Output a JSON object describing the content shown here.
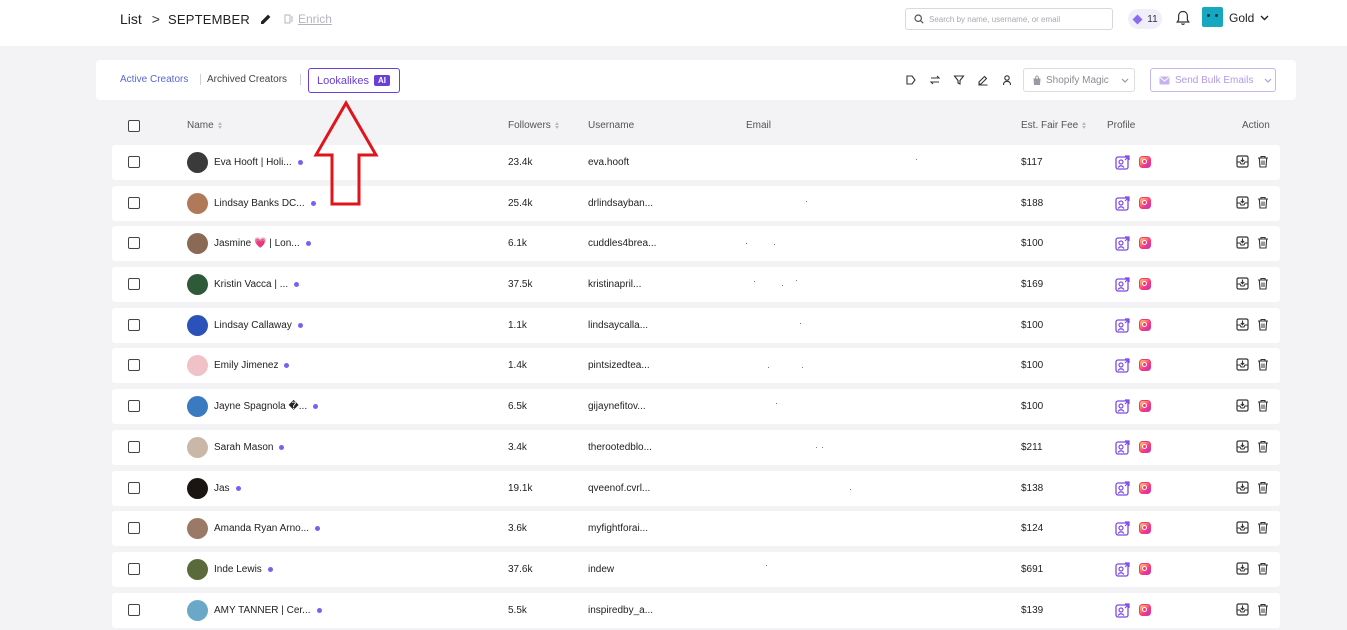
{
  "header": {
    "breadcrumb_root": "List",
    "breadcrumb_sep": ">",
    "list_name": "SEPTEMBER",
    "enrich_label": "Enrich",
    "search_placeholder": "Search by name, username, or email",
    "credits": "11",
    "plan": "Gold"
  },
  "tabs": {
    "active": "Active Creators",
    "archived": "Archived Creators",
    "lookalikes": "Lookalikes",
    "ai_badge": "AI"
  },
  "toolbar": {
    "shopify_label": "Shopify Magic",
    "bulk_email_label": "Send Bulk Emails",
    "icons": [
      "tag-icon",
      "swap-icon",
      "filter-icon",
      "edit-icon",
      "user-icon"
    ]
  },
  "columns": {
    "name": "Name",
    "followers": "Followers",
    "username": "Username",
    "email": "Email",
    "fee": "Est. Fair Fee",
    "profile": "Profile",
    "action": "Action"
  },
  "rows": [
    {
      "name": "Eva Hooft | Holi...",
      "followers": "23.4k",
      "username": "eva.hooft",
      "fee": "$117",
      "avatar_color": "#3a3a3a"
    },
    {
      "name": "Lindsay Banks DC...",
      "followers": "25.4k",
      "username": "drlindsayban...",
      "fee": "$188",
      "avatar_color": "#b07a5a"
    },
    {
      "name": "Jasmine 💗 | Lon...",
      "followers": "6.1k",
      "username": "cuddles4brea...",
      "fee": "$100",
      "avatar_color": "#8a6a55"
    },
    {
      "name": "Kristin Vacca | ...",
      "followers": "37.5k",
      "username": "kristinapril...",
      "fee": "$169",
      "avatar_color": "#2f5a3a"
    },
    {
      "name": "Lindsay Callaway",
      "followers": "1.1k",
      "username": "lindsaycalla...",
      "fee": "$100",
      "avatar_color": "#2a52b8"
    },
    {
      "name": "Emily Jimenez",
      "followers": "1.4k",
      "username": "pintsizedtea...",
      "fee": "$100",
      "avatar_color": "#f0c2c8"
    },
    {
      "name": "Jayne Spagnola �...",
      "followers": "6.5k",
      "username": "gijaynefitov...",
      "fee": "$100",
      "avatar_color": "#3a7ac0"
    },
    {
      "name": "Sarah Mason",
      "followers": "3.4k",
      "username": "therootedblo...",
      "fee": "$211",
      "avatar_color": "#c9b8a8"
    },
    {
      "name": "Jas",
      "followers": "19.1k",
      "username": "qveenof.cvrl...",
      "fee": "$138",
      "avatar_color": "#1a1412"
    },
    {
      "name": "Amanda Ryan Arno...",
      "followers": "3.6k",
      "username": "myfightforai...",
      "fee": "$124",
      "avatar_color": "#9a7a66"
    },
    {
      "name": "Inde Lewis",
      "followers": "37.6k",
      "username": "indew",
      "fee": "$691",
      "avatar_color": "#5a6a3a"
    },
    {
      "name": "AMY TANNER | Cer...",
      "followers": "5.5k",
      "username": "inspiredby_a...",
      "fee": "$139",
      "avatar_color": "#6aa8c8"
    }
  ],
  "colors": {
    "accent": "#6a3fd6",
    "link": "#5b66d6",
    "annotation_arrow": "#e0141b"
  }
}
